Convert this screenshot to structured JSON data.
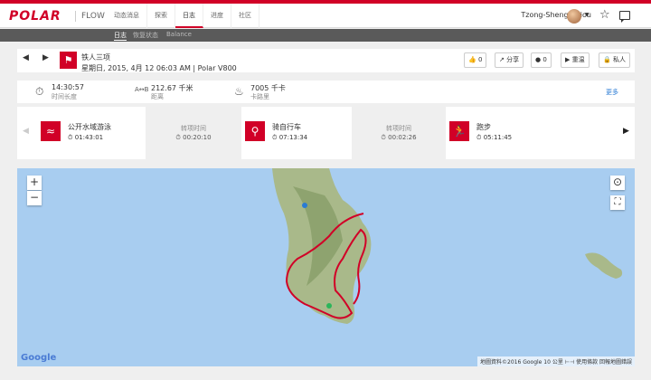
{
  "brand": {
    "logo": "POLAR",
    "product": "FLOW"
  },
  "nav": {
    "items": [
      "动态消息",
      "探索",
      "日志",
      "进度",
      "社区"
    ],
    "active_index": 2
  },
  "user": {
    "name": "Tzong-Sheng Chiou"
  },
  "subnav": {
    "items": [
      "日志",
      "恢复状态",
      "Balance"
    ]
  },
  "session": {
    "title": "铁人三项",
    "date_line": "星期日, 2015, 4月 12 06:03 AM | Polar V800",
    "actions": {
      "likes": "0",
      "share": "分享",
      "comments": "0",
      "replay": "重温",
      "privacy": "私人"
    }
  },
  "stats": [
    {
      "icon": "stopwatch-icon",
      "value": "14:30:57",
      "label": "时间长度"
    },
    {
      "icon": "distance-icon",
      "value": "212.67 千米",
      "label": "距离"
    },
    {
      "icon": "flame-icon",
      "value": "7005 千卡",
      "label": "卡路里"
    }
  ],
  "stats_more": "更多",
  "legs": [
    {
      "kind": "sport",
      "name": "公开水域游泳",
      "time": "01:43:01",
      "icon": "swim-icon"
    },
    {
      "kind": "transition",
      "name": "转项时间",
      "time": "00:20:10"
    },
    {
      "kind": "sport",
      "name": "骑自行车",
      "time": "07:13:34",
      "icon": "bike-icon"
    },
    {
      "kind": "transition",
      "name": "转项时间",
      "time": "00:02:26"
    },
    {
      "kind": "sport",
      "name": "跑步",
      "time": "05:11:45",
      "icon": "run-icon"
    }
  ],
  "map": {
    "zoom_in": "+",
    "zoom_out": "−",
    "google": "Google",
    "attribution": "地圖資料©2016 Google    10 公里 ⊢⊣    使用條款    回報地圖錯誤"
  },
  "colors": {
    "accent": "#d10027",
    "water": "#a8cdf0",
    "land": "#a9b98a"
  }
}
